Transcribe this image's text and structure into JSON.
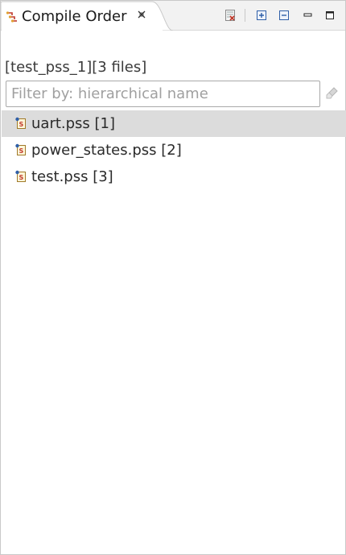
{
  "tab": {
    "title": "Compile Order",
    "icon": "compile-order-icon",
    "close_icon": "close-icon"
  },
  "toolbar": {
    "buttons": [
      {
        "name": "export-icon"
      },
      {
        "name": "expand-all-icon"
      },
      {
        "name": "collapse-all-icon"
      },
      {
        "name": "minimize-icon"
      },
      {
        "name": "maximize-icon"
      }
    ]
  },
  "summary": "[test_pss_1][3 files]",
  "filter": {
    "value": "",
    "placeholder": "Filter by: hierarchical name",
    "clear_icon": "clear-filter-icon"
  },
  "files": [
    {
      "label": "uart.pss [1]",
      "icon": "pss-file-icon",
      "selected": true
    },
    {
      "label": "power_states.pss [2]",
      "icon": "pss-file-icon",
      "selected": false
    },
    {
      "label": "test.pss [3]",
      "icon": "pss-file-icon",
      "selected": false
    }
  ],
  "colors": {
    "selection": "#dcdcdc",
    "tabstrip": "#f2f2f2",
    "icon_red": "#c0392b",
    "icon_blue": "#2f5fa8"
  }
}
